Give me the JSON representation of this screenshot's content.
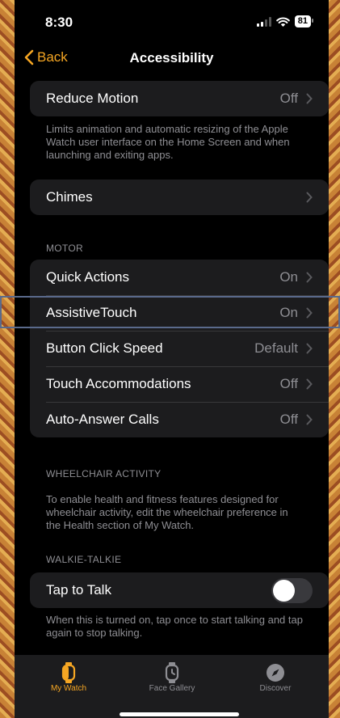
{
  "status": {
    "time": "8:30",
    "battery": "81"
  },
  "nav": {
    "back_label": "Back",
    "title": "Accessibility"
  },
  "reduce_motion": {
    "label": "Reduce Motion",
    "value": "Off",
    "footer": "Limits animation and automatic resizing of the Apple Watch user interface on the Home Screen and when launching and exiting apps."
  },
  "chimes": {
    "label": "Chimes"
  },
  "motor": {
    "header": "MOTOR",
    "items": [
      {
        "label": "Quick Actions",
        "value": "On"
      },
      {
        "label": "AssistiveTouch",
        "value": "On"
      },
      {
        "label": "Button Click Speed",
        "value": "Default"
      },
      {
        "label": "Touch Accommodations",
        "value": "Off"
      },
      {
        "label": "Auto-Answer Calls",
        "value": "Off"
      }
    ]
  },
  "wheelchair": {
    "header": "WHEELCHAIR ACTIVITY",
    "footer": "To enable health and fitness features designed for wheelchair activity, edit the wheelchair preference in the Health section of My Watch."
  },
  "walkie_talkie": {
    "header": "WALKIE-TALKIE",
    "label": "Tap to Talk",
    "enabled": false,
    "footer": "When this is turned on, tap once to start talking and tap again to stop talking."
  },
  "tabs": [
    {
      "label": "My Watch",
      "icon": "watch-icon",
      "active": true
    },
    {
      "label": "Face Gallery",
      "icon": "watch-face-icon",
      "active": false
    },
    {
      "label": "Discover",
      "icon": "compass-icon",
      "active": false
    }
  ],
  "colors": {
    "accent": "#f5a623",
    "background": "#000000",
    "cell": "#1c1c1e",
    "secondary_text": "#8e8e93"
  }
}
